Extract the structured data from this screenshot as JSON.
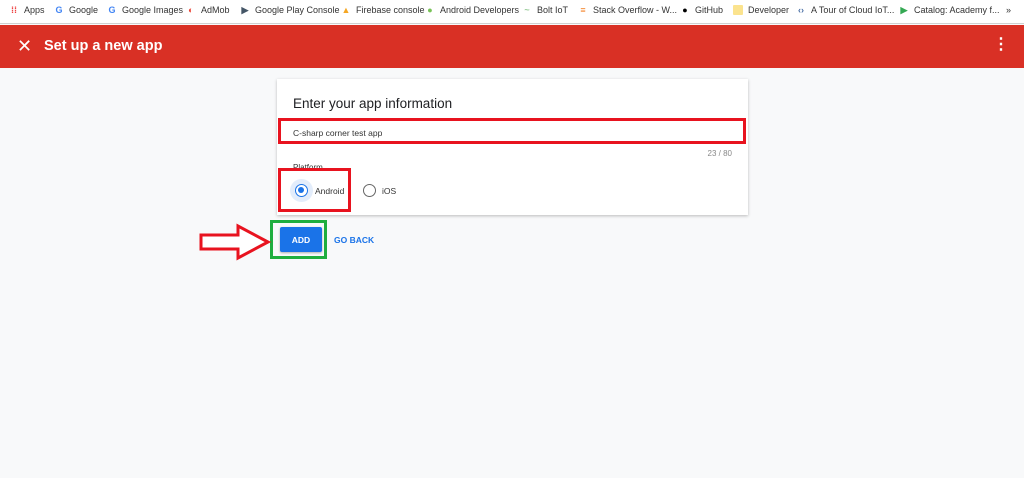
{
  "bookmarks": [
    {
      "label": "Apps",
      "icon": "apps-grid-icon"
    },
    {
      "label": "Google",
      "icon": "google-icon"
    },
    {
      "label": "Google Images",
      "icon": "google-icon"
    },
    {
      "label": "AdMob",
      "icon": "admob-icon"
    },
    {
      "label": "Google Play Console",
      "icon": "play-console-icon"
    },
    {
      "label": "Firebase console",
      "icon": "firebase-icon"
    },
    {
      "label": "Android Developers",
      "icon": "android-icon"
    },
    {
      "label": "Bolt IoT",
      "icon": "bolt-iot-icon"
    },
    {
      "label": "Stack Overflow - W...",
      "icon": "stack-overflow-icon"
    },
    {
      "label": "GitHub",
      "icon": "github-icon"
    },
    {
      "label": "Developer",
      "icon": "folder-icon"
    },
    {
      "label": "A Tour of Cloud IoT...",
      "icon": "cloud-iot-icon"
    },
    {
      "label": "Catalog: Academy f...",
      "icon": "play-icon"
    }
  ],
  "overflow": "»",
  "appbar": {
    "title": "Set up a new app",
    "close": "✕",
    "more": "⋮"
  },
  "card": {
    "title": "Enter your app information",
    "app_name": "C-sharp corner test app",
    "counter": "23 / 80",
    "platform_label": "Platform",
    "options": [
      {
        "label": "Android",
        "selected": true
      },
      {
        "label": "iOS",
        "selected": false
      }
    ]
  },
  "actions": {
    "add": "ADD",
    "back": "GO BACK"
  },
  "colors": {
    "appbar": "#d93025",
    "primary": "#1a73e8",
    "highlight_red": "#e8131f",
    "highlight_green": "#1fae3f"
  }
}
